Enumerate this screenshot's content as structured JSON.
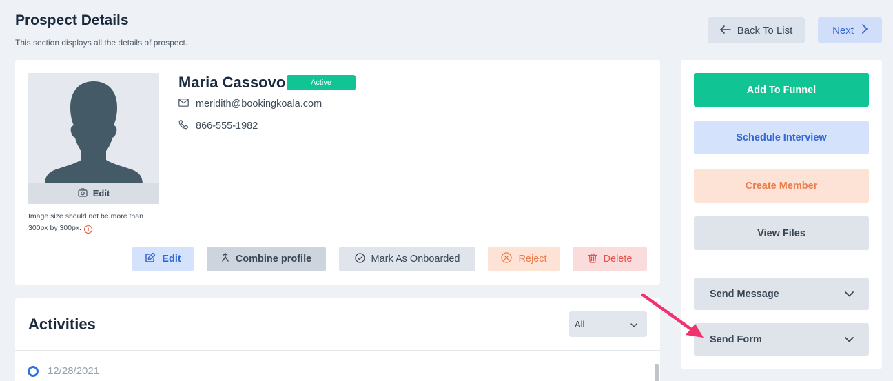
{
  "header": {
    "title": "Prospect Details",
    "subtitle": "This section displays all the details of prospect.",
    "back_label": "Back To List",
    "next_label": "Next"
  },
  "profile": {
    "name": "Maria Cassovo",
    "status": "Active",
    "email": "meridith@bookingkoala.com",
    "phone": "866-555-1982",
    "avatar_edit_label": "Edit",
    "image_note": "Image size should not be more than 300px by 300px.",
    "actions": {
      "edit": "Edit",
      "combine": "Combine profile",
      "onboard": "Mark As Onboarded",
      "reject": "Reject",
      "delete": "Delete"
    }
  },
  "activities": {
    "title": "Activities",
    "filter_value": "All",
    "items": [
      {
        "date": "12/28/2021"
      }
    ]
  },
  "sidebar": {
    "add_to_funnel": "Add To Funnel",
    "schedule_interview": "Schedule Interview",
    "create_member": "Create Member",
    "view_files": "View Files",
    "send_message": "Send Message",
    "send_form": "Send Form"
  },
  "colors": {
    "accent_green": "#10c493",
    "accent_blue": "#3568d4",
    "accent_orange": "#ef7c4c",
    "danger_red": "#e65050",
    "annotation_arrow": "#f0326e"
  },
  "icons": {
    "back": "arrow-left-icon",
    "next": "chevron-right-icon",
    "email": "envelope-icon",
    "phone": "phone-icon",
    "avatar_edit": "camera-icon",
    "edit": "edit-icon",
    "combine": "merge-icon",
    "onboard": "check-circle-icon",
    "reject": "x-circle-icon",
    "delete": "trash-icon",
    "dropdown": "chevron-down-icon"
  }
}
